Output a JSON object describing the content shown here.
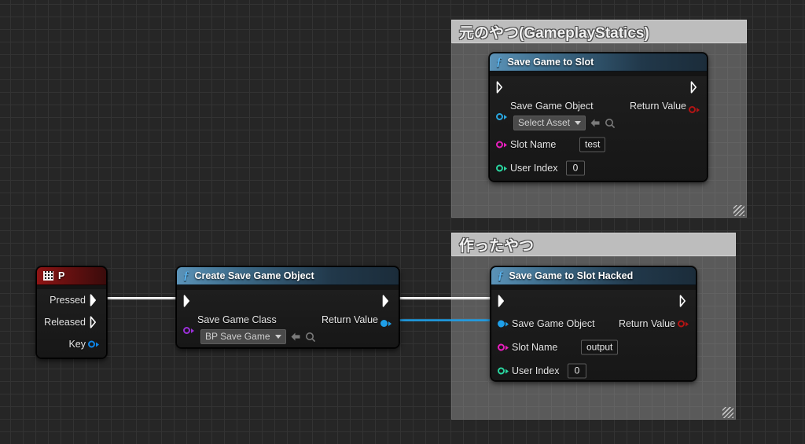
{
  "app": {
    "title": "Unreal Engine Blueprint Graph",
    "canvas_bg": "#262626",
    "grid_minor": "#333333",
    "grid_major": "#0b0b0b"
  },
  "comments": [
    {
      "id": "comment-original",
      "title": "元のやつ(GameplayStatics)",
      "color": "#bdbdbd"
    },
    {
      "id": "comment-custom",
      "title": "作ったやつ",
      "color": "#bdbdbd"
    }
  ],
  "nodes": {
    "input_event": {
      "title": "P",
      "icon": "keyboard-key-icon",
      "header_color": "#8e1414",
      "pins": [
        {
          "label": "Pressed",
          "type": "exec",
          "side": "out",
          "connected": true
        },
        {
          "label": "Released",
          "type": "exec",
          "side": "out",
          "connected": false
        },
        {
          "label": "Key",
          "type": "data",
          "side": "out",
          "color": "#0e86e8",
          "connected": false
        }
      ]
    },
    "create_save_game": {
      "title": "Create Save Game Object",
      "icon": "function-f-icon",
      "header_color": "#3e6d8c",
      "exec_in_connected": true,
      "exec_out_connected": true,
      "in_label": "Save Game Class",
      "in_pin_color": "#9b30d9",
      "in_value": "BP Save Game",
      "out_label": "Return Value",
      "out_pin_color": "#1f9fe8",
      "out_connected": true
    },
    "save_game_to_slot": {
      "title": "Save Game to Slot",
      "icon": "function-f-icon",
      "header_color": "#3e6d8c",
      "exec_in_connected": false,
      "exec_out_connected": false,
      "rows": [
        {
          "label": "Save Game Object",
          "pin_color": "#2aa7e0",
          "connected": false,
          "widget": "combo",
          "value": "Select Asset"
        },
        {
          "label": "Slot Name",
          "pin_color": "#e81fbe",
          "connected": false,
          "widget": "text",
          "value": "test"
        },
        {
          "label": "User Index",
          "pin_color": "#2ad6a0",
          "connected": false,
          "widget": "text",
          "value": "0"
        }
      ],
      "out_label": "Return Value",
      "out_pin_color": "#b31414",
      "out_connected": false
    },
    "save_game_to_slot_hacked": {
      "title": "Save Game to Slot Hacked",
      "icon": "function-f-icon",
      "header_color": "#3e6d8c",
      "exec_in_connected": true,
      "exec_out_connected": false,
      "rows": [
        {
          "label": "Save Game Object",
          "pin_color": "#1f9fe8",
          "connected": true,
          "widget": "none",
          "value": ""
        },
        {
          "label": "Slot Name",
          "pin_color": "#e81fbe",
          "connected": false,
          "widget": "text",
          "value": "output"
        },
        {
          "label": "User Index",
          "pin_color": "#2ad6a0",
          "connected": false,
          "widget": "text",
          "value": "0"
        }
      ],
      "out_label": "Return Value",
      "out_pin_color": "#b31414",
      "out_connected": false
    }
  },
  "wires": [
    {
      "name": "wire-pressed-to-create-exec",
      "type": "exec",
      "color": "#ffffff"
    },
    {
      "name": "wire-create-exec-to-hacked-exec",
      "type": "exec",
      "color": "#ffffff"
    },
    {
      "name": "wire-create-return-to-hacked-object",
      "type": "data",
      "color": "#1f9fe8"
    }
  ]
}
